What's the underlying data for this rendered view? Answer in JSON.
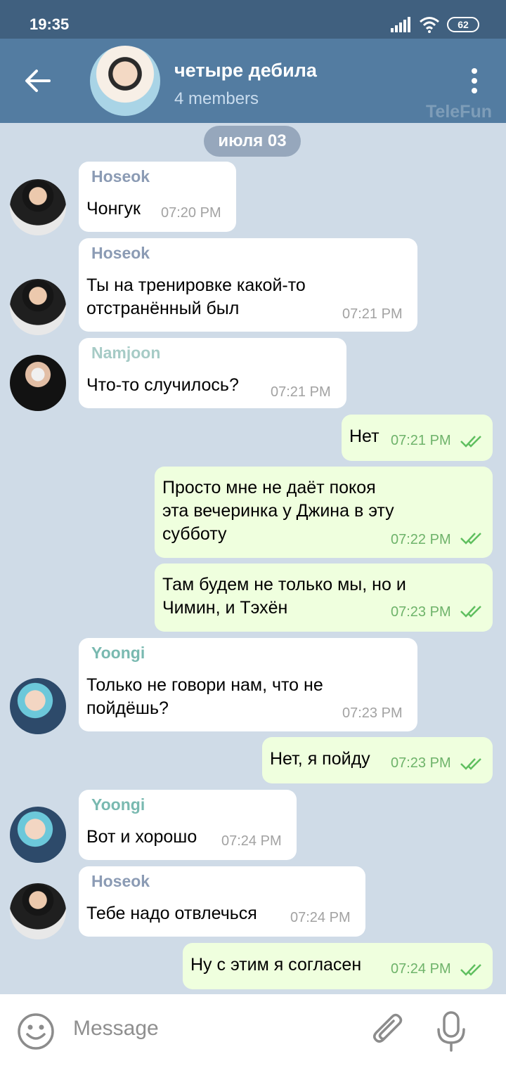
{
  "status": {
    "time": "19:35",
    "battery": "62",
    "icons": [
      "signal-icon",
      "wifi-icon",
      "battery-icon"
    ]
  },
  "header": {
    "title": "четыре дебила",
    "subtitle": "4 members",
    "watermark": "TeleFun"
  },
  "date_label": "июля 03",
  "messages": [
    {
      "direction": "in",
      "sender": "Hoseok",
      "sender_color": "#8b9bb4",
      "text": "Чонгук",
      "time": "07:20 PM"
    },
    {
      "direction": "in",
      "sender": "Hoseok",
      "sender_color": "#8b9bb4",
      "text": "Ты на тренировке какой-то\nотстранённый был",
      "time": "07:21 PM"
    },
    {
      "direction": "in",
      "sender": "Namjoon",
      "sender_color": "#a6cbc6",
      "text": "Что-то случилось?",
      "time": "07:21 PM"
    },
    {
      "direction": "out",
      "text": "Нет",
      "time": "07:21 PM",
      "read": true
    },
    {
      "direction": "out",
      "text": "Просто мне не даёт покоя\nэта вечеринка у Джина в эту\nсубботу",
      "time": "07:22 PM",
      "read": true
    },
    {
      "direction": "out",
      "text": "Там будем не только мы, но и\nЧимин, и Тэхён",
      "time": "07:23 PM",
      "read": true
    },
    {
      "direction": "in",
      "sender": "Yoongi",
      "sender_color": "#79b9b0",
      "text": "Только не говори нам, что не\nпойдёшь?",
      "time": "07:23 PM"
    },
    {
      "direction": "out",
      "text": "Нет, я пойду",
      "time": "07:23 PM",
      "read": true
    },
    {
      "direction": "in",
      "sender": "Yoongi",
      "sender_color": "#79b9b0",
      "text": "Вот и хорошо",
      "time": "07:24 PM"
    },
    {
      "direction": "in",
      "sender": "Hoseok",
      "sender_color": "#8b9bb4",
      "text": "Тебе надо отвлечься",
      "time": "07:24 PM"
    },
    {
      "direction": "out",
      "text": "Ну с этим я согласен",
      "time": "07:24 PM",
      "read": true
    }
  ],
  "input": {
    "placeholder": "Message"
  },
  "colors": {
    "header": "#537ca1",
    "status_bar": "#40607f",
    "outgoing_bubble": "#efffde",
    "incoming_bubble": "#ffffff",
    "read_ticks": "#5fbf5f"
  }
}
